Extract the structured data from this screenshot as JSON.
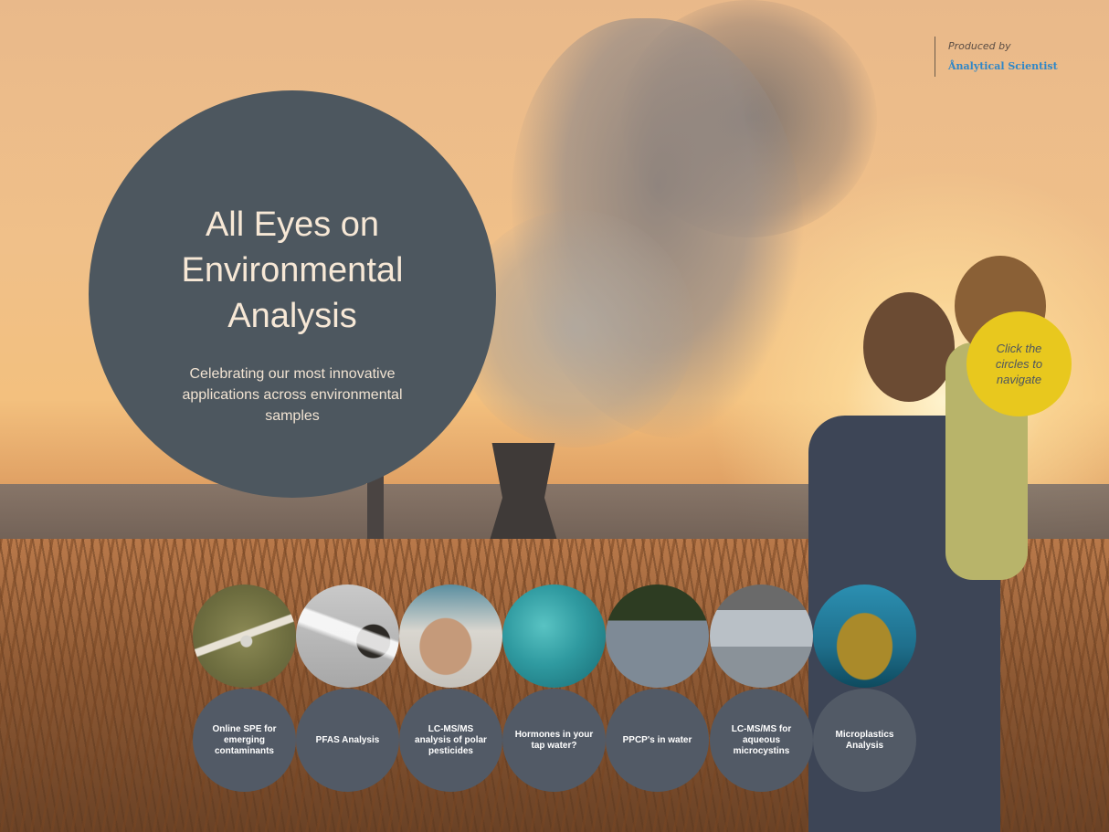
{
  "brand": {
    "produced_by": "Produced by",
    "name": "Ånalytical Scientist"
  },
  "hero": {
    "title": "All Eyes on Environmental Analysis",
    "subtitle": "Celebrating our most innovative applications across environmental samples"
  },
  "hint": {
    "text": "Click the circles to navigate"
  },
  "nav": {
    "items": [
      {
        "label": "Online SPE for emerging contaminants",
        "thumb_icon": "kayak-image-icon"
      },
      {
        "label": "PFAS Analysis",
        "thumb_icon": "firefighter-image-icon"
      },
      {
        "label": "LC-MS/MS analysis of polar pesticides",
        "thumb_icon": "water-hands-image-icon"
      },
      {
        "label": "Hormones in your tap water?",
        "thumb_icon": "bubbles-image-icon"
      },
      {
        "label": "PPCP's in water",
        "thumb_icon": "polluted-water-image-icon"
      },
      {
        "label": "LC-MS/MS for aqueous microcystins",
        "thumb_icon": "lab-water-image-icon"
      },
      {
        "label": "Microplastics Analysis",
        "thumb_icon": "turtle-image-icon"
      }
    ]
  },
  "colors": {
    "hero_circle": "#4d575f",
    "hint_circle": "#e8c81e",
    "label_circle": "#525a66",
    "brand_accent": "#2f87c8"
  }
}
